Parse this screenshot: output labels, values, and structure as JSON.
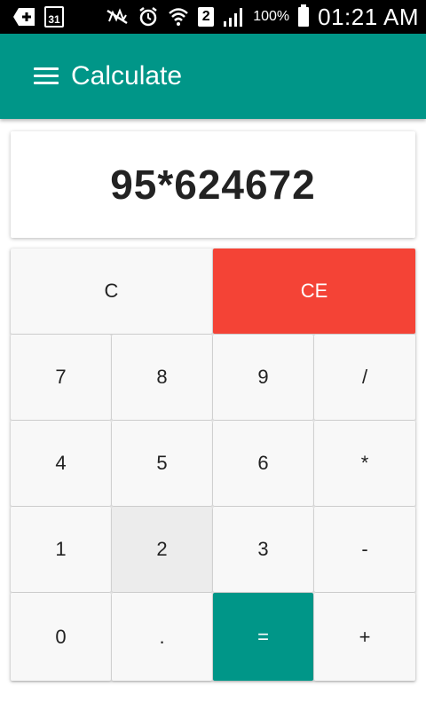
{
  "status_bar": {
    "calendar_day": "31",
    "sim_slot": "2",
    "battery_pct": "100%",
    "time": "01:21 AM"
  },
  "app_bar": {
    "title": "Calculate"
  },
  "display": {
    "expression": "95*624672"
  },
  "keypad": {
    "clear": "C",
    "clear_entry": "CE",
    "row1": [
      "7",
      "8",
      "9",
      "/"
    ],
    "row2": [
      "4",
      "5",
      "6",
      "*"
    ],
    "row3": [
      "1",
      "2",
      "3",
      "-"
    ],
    "row4": [
      "0",
      ".",
      "=",
      "+"
    ]
  },
  "colors": {
    "primary": "#009688",
    "clear_entry_red": "#f44336",
    "key_bg": "#f8f8f8",
    "pressed_key_bg": "#ececec"
  },
  "icons": [
    "add-notification-icon",
    "calendar-icon",
    "mute-icon",
    "alarm-icon",
    "wifi-icon",
    "signal-icon",
    "battery-icon",
    "menu-icon"
  ]
}
